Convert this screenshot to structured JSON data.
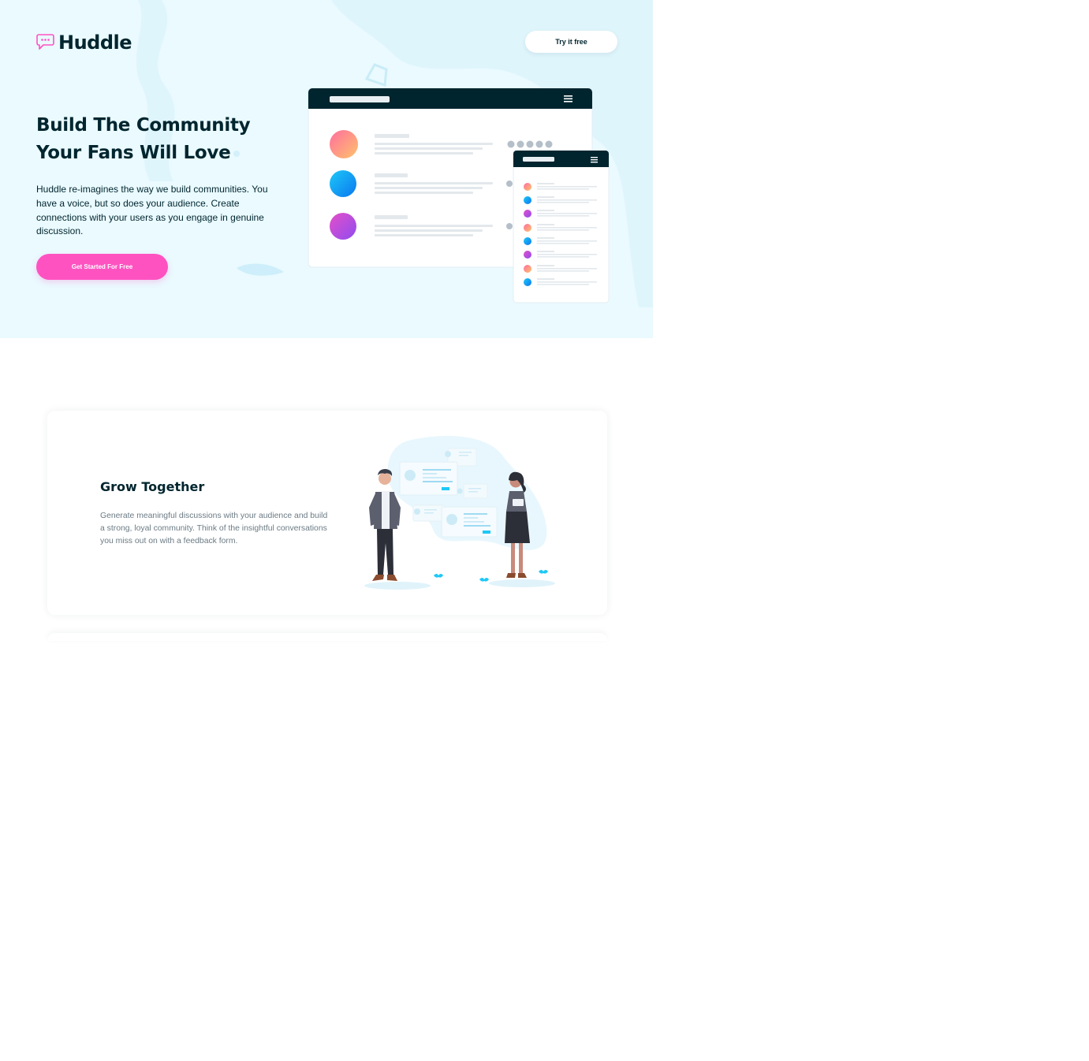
{
  "brand": {
    "name": "Huddle",
    "icon": "chat-bubble-icon",
    "accent": "#ff52c1",
    "dark": "#00252e",
    "hero_bg": "#eafaff"
  },
  "header": {
    "cta_label": "Try it free"
  },
  "hero": {
    "title_line1": "Build The Community",
    "title_line2": "Your Fans Will Love",
    "description": "Huddle re-imagines the way we build communities. You have a voice, but so does your audience. Create connections with your users as you engage in genuine discussion.",
    "cta_label": "Get Started For Free",
    "illustration": "app-mockup-illustration"
  },
  "features": [
    {
      "title": "Grow Together",
      "description": "Generate meaningful discussions with your audience and build a strong, loyal community. Think of the insightful conversations you miss out on with a feedback form.",
      "illustration": "two-people-discussion-illustration"
    }
  ]
}
